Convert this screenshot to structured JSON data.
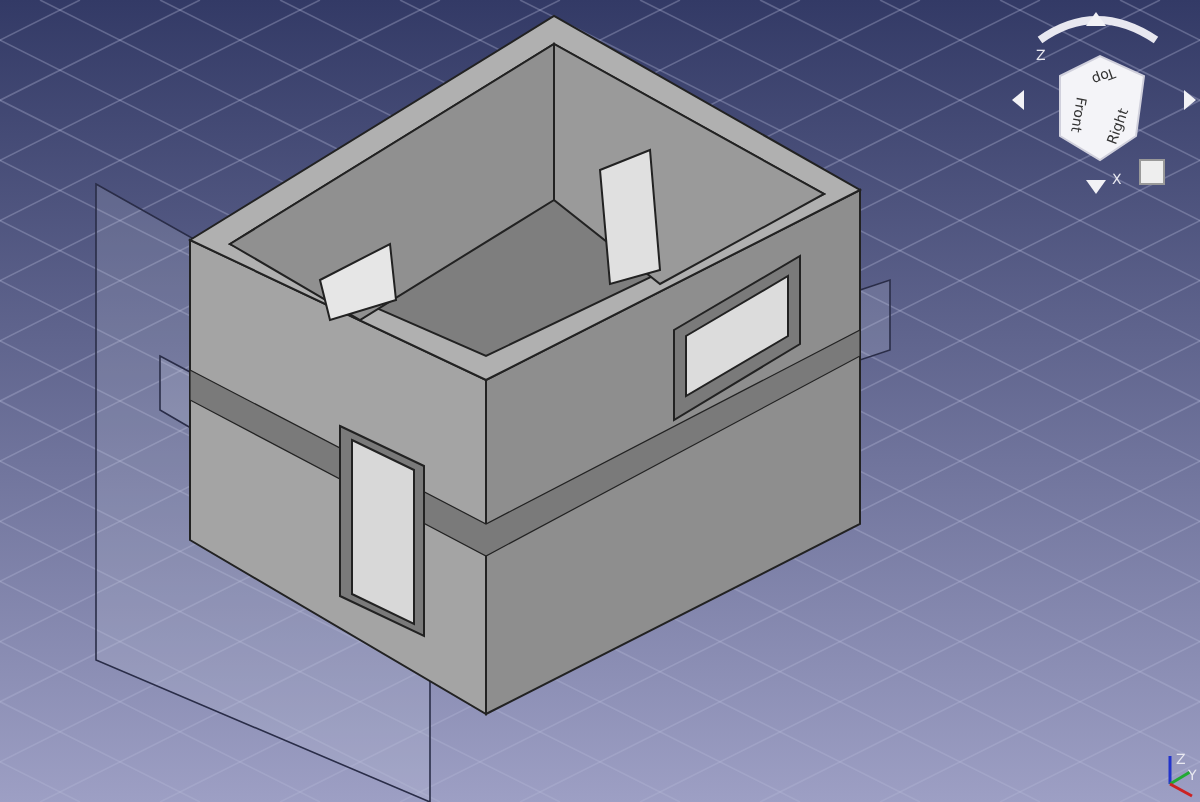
{
  "navigation_cube": {
    "faces": [
      {
        "label": "Top"
      },
      {
        "label": "Front"
      },
      {
        "label": "Right"
      }
    ],
    "axes": [
      {
        "label": "Z"
      },
      {
        "label": "X"
      }
    ]
  },
  "axis_indicator": {
    "axes": [
      {
        "label": "Z"
      },
      {
        "label": "Y"
      }
    ]
  }
}
